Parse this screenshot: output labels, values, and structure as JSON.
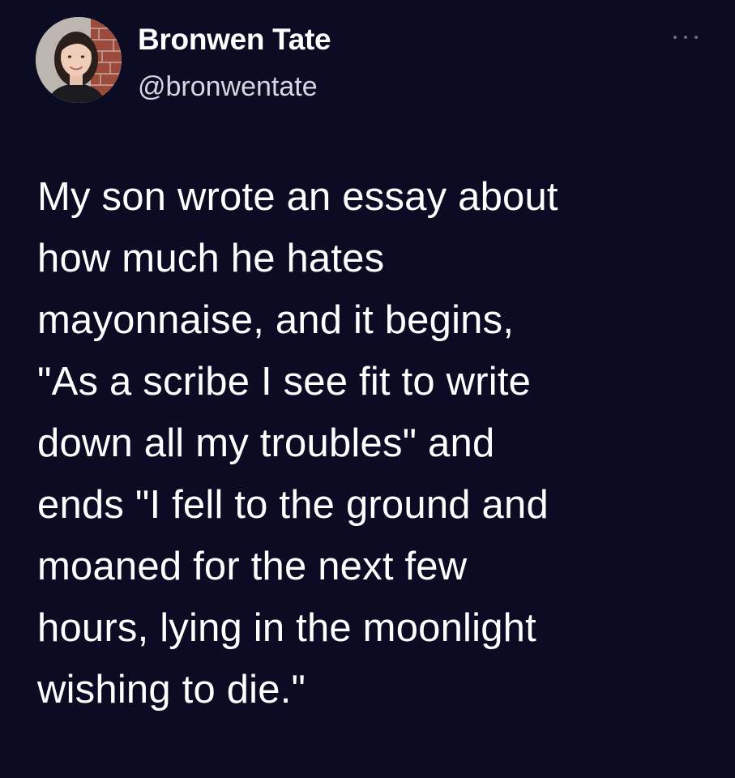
{
  "author": {
    "name": "Bronwen Tate",
    "handle": "@bronwentate",
    "avatar_icon": "profile-photo-avatar"
  },
  "menu": {
    "icon": "more-options-icon"
  },
  "tweet": {
    "lines": [
      "My son wrote an essay about",
      "how much he hates",
      "mayonnaise, and it begins,",
      "\"As a scribe I see fit to write",
      "down all my troubles\" and",
      "ends \"I fell to the ground and",
      "moaned for the next few",
      "hours, lying in the moonlight",
      "wishing to die.\""
    ]
  },
  "colors": {
    "background": "#0b0c24",
    "text": "#ffffff",
    "handle": "#d6d7e0"
  }
}
